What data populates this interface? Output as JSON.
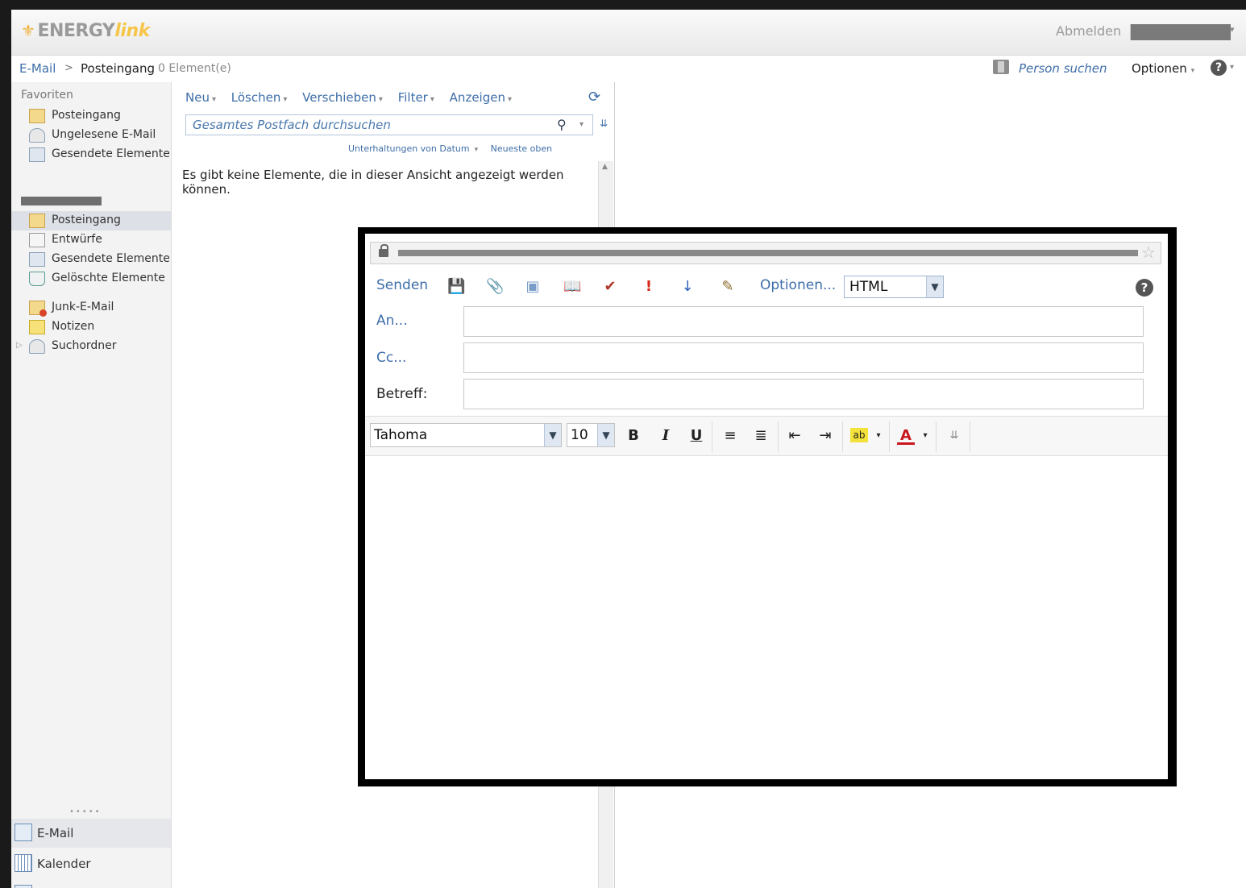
{
  "header": {
    "logo_energy": "ENERGY",
    "logo_link": "link",
    "abmelden": "Abmelden"
  },
  "breadcrumb": {
    "mail": "E-Mail",
    "separator": ">",
    "folder": "Posteingang",
    "count": "0 Element(e)",
    "person_suchen": "Person suchen",
    "optionen": "Optionen",
    "help": "?"
  },
  "nav": {
    "favorites_title": "Favoriten",
    "favorites": [
      {
        "label": "Posteingang",
        "icon": "inbox-icon"
      },
      {
        "label": "Ungelesene E-Mail",
        "icon": "search-folder-icon"
      },
      {
        "label": "Gesendete Elemente",
        "icon": "sent-icon"
      }
    ],
    "folders": [
      {
        "label": "Posteingang",
        "icon": "inbox-icon",
        "selected": true
      },
      {
        "label": "Entwürfe",
        "icon": "drafts-icon"
      },
      {
        "label": "Gesendete Elemente",
        "icon": "sent-icon"
      },
      {
        "label": "Gelöschte Elemente",
        "icon": "trash-icon"
      },
      {
        "label": "Junk-E-Mail",
        "icon": "junk-icon"
      },
      {
        "label": "Notizen",
        "icon": "notes-icon"
      },
      {
        "label": "Suchordner",
        "icon": "search-folder-icon"
      }
    ],
    "modules": [
      {
        "label": "E-Mail",
        "icon": "mail-icon",
        "selected": true
      },
      {
        "label": "Kalender",
        "icon": "calendar-icon"
      }
    ]
  },
  "list": {
    "toolbar": [
      "Neu",
      "Löschen",
      "Verschieben",
      "Filter",
      "Anzeigen"
    ],
    "search_placeholder": "Gesamtes Postfach durchsuchen",
    "sort_by": "Unterhaltungen von Datum",
    "sort_order": "Neueste oben",
    "empty_message": "Es gibt keine Elemente, die in dieser Ansicht angezeigt werden können."
  },
  "compose": {
    "send": "Senden",
    "options": "Optionen...",
    "format": "HTML",
    "to_label": "An...",
    "cc_label": "Cc...",
    "subject_label": "Betreff:",
    "to_value": "",
    "cc_value": "",
    "subject_value": "",
    "font": "Tahoma",
    "size": "10",
    "bold": "B",
    "italic": "I",
    "underline": "U",
    "help": "?"
  },
  "colors": {
    "link": "#3e6ea8",
    "logo_accent": "#f6c64a",
    "selected_row": "#dde0e6"
  }
}
